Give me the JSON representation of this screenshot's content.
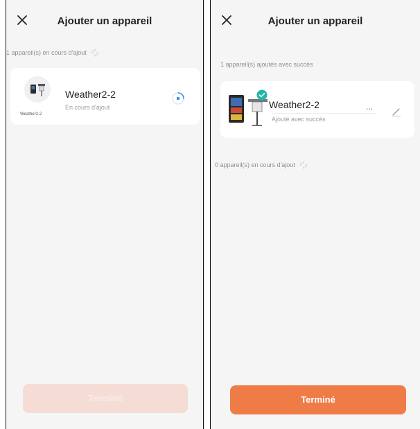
{
  "left_screen": {
    "title": "Ajouter un appareil",
    "progress_label": "1 appareil(s) en cours d'ajout",
    "device": {
      "thumb_caption": "Weather2-2",
      "name": "Weather2-2",
      "status": "En cours d'ajout"
    },
    "done_label": "Terminé"
  },
  "right_screen": {
    "title": "Ajouter un appareil",
    "success_label": "1 appareil(s) ajoutés avec succès",
    "device": {
      "name": "Weather2-2",
      "ellipsis": "...",
      "status": "Ajouté avec succès"
    },
    "progress_label": "0 appareil(s) en cours d'ajout",
    "done_label": "Terminé"
  },
  "colors": {
    "accent": "#ef7b47",
    "accent_disabled": "#f5ddd6",
    "success_badge": "#22b8a8",
    "progress_blue": "#3a8ee8",
    "background": "#f5f5f6"
  }
}
